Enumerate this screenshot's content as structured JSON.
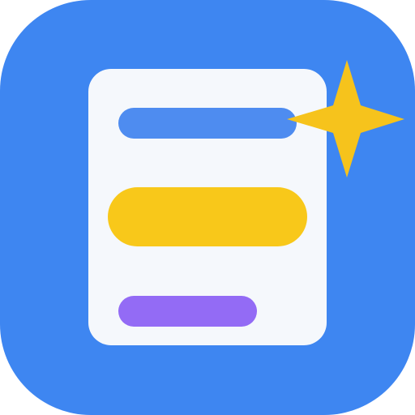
{
  "icon": {
    "name": "document-sparkle-app-icon",
    "colors": {
      "tile": "#3E86F1",
      "card": "#F5F8FC",
      "bar_top": "#4E8CF0",
      "bar_middle": "#F8C81A",
      "bar_bottom": "#936BF5",
      "sparkle": "#F6C31C"
    }
  }
}
